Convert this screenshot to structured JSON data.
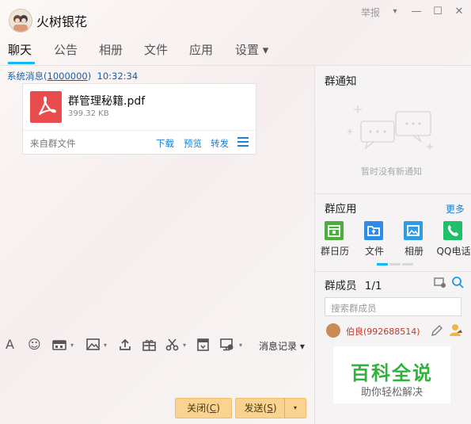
{
  "window": {
    "title": "火树银花",
    "report_label": "举报",
    "report_caret": "▾",
    "minimize_glyph": "—",
    "maximize_glyph": "☐",
    "close_glyph": "✕"
  },
  "tabs": [
    {
      "label": "聊天",
      "active": true
    },
    {
      "label": "公告"
    },
    {
      "label": "相册"
    },
    {
      "label": "文件"
    },
    {
      "label": "应用"
    },
    {
      "label": "设置 ▾"
    }
  ],
  "chat": {
    "system_prefix": "系统消息(",
    "system_id": "1000000",
    "system_suffix": ")",
    "system_time": "10:32:34",
    "file": {
      "name": "群管理秘籍.pdf",
      "size": "399.32 KB",
      "source": "来自群文件",
      "actions": [
        "下载",
        "预览",
        "转发"
      ]
    }
  },
  "toolbar": {
    "font_glyph": "A",
    "emoji_glyph": "☺",
    "history_label": "消息记录 ▾"
  },
  "buttons": {
    "close_text": "关闭(",
    "close_key": "C",
    "close_end": ")",
    "send_text": "发送(",
    "send_key": "S",
    "send_end": ")",
    "send_caret": "▾"
  },
  "right_panel": {
    "notice_title": "群通知",
    "notice_empty": "暂时没有新通知",
    "apps_title": "群应用",
    "apps_more": "更多",
    "apps": [
      {
        "label": "群日历",
        "icon": "calendar-icon",
        "color": "#4caf3c"
      },
      {
        "label": "文件",
        "icon": "folder-upload-icon",
        "color": "#2f8ce6"
      },
      {
        "label": "相册",
        "icon": "photo-icon",
        "color": "#2f9be6"
      },
      {
        "label": "QQ电话",
        "icon": "phone-icon",
        "color": "#1fbf6b"
      }
    ],
    "members_title": "群成员",
    "members_count": "1/1",
    "search_placeholder": "搜索群成员",
    "members": [
      {
        "name": "伯良(992688514)"
      }
    ]
  },
  "watermark": {
    "line1": "百科全说",
    "line2": "助你轻松解决"
  },
  "colors": {
    "accent": "#12b7f5",
    "link": "#1a7fd6",
    "button": "#fad391",
    "pdf": "#e84c4c",
    "member_name": "#c0392b",
    "watermark_green": "#2eb33b"
  }
}
